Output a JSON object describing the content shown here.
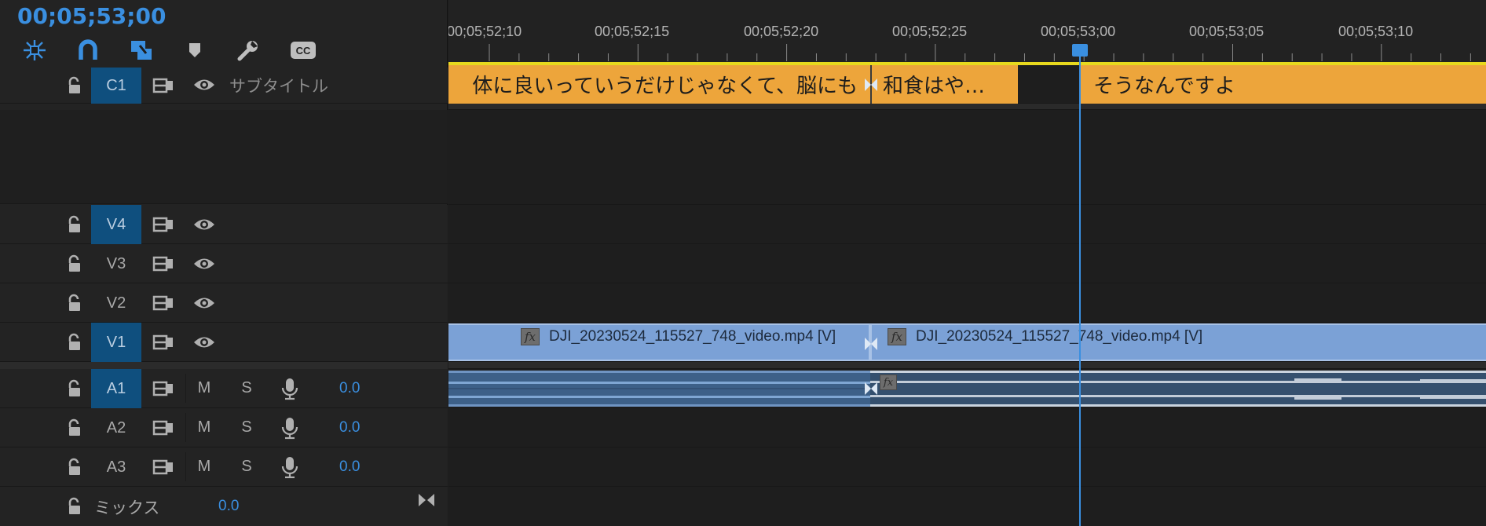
{
  "timecode": "00;05;53;00",
  "toolbar": {
    "tools": [
      {
        "icon": "nest-sequence-icon"
      },
      {
        "icon": "snap-magnet-icon"
      },
      {
        "icon": "linked-selection-icon"
      },
      {
        "icon": "add-marker-icon"
      },
      {
        "icon": "settings-wrench-icon"
      },
      {
        "icon": "captions-cc-icon",
        "text": "CC"
      }
    ]
  },
  "tracks": {
    "c1": {
      "name": "C1",
      "label": "サブタイトル"
    },
    "v4": {
      "name": "V4"
    },
    "v3": {
      "name": "V3"
    },
    "v2": {
      "name": "V2"
    },
    "v1": {
      "name": "V1"
    },
    "a1": {
      "name": "A1",
      "m": "M",
      "s": "S",
      "volume": "0.0"
    },
    "a2": {
      "name": "A2",
      "m": "M",
      "s": "S",
      "volume": "0.0"
    },
    "a3": {
      "name": "A3",
      "m": "M",
      "s": "S",
      "volume": "0.0"
    },
    "mix": {
      "label": "ミックス",
      "volume": "0.0"
    }
  },
  "ruler": {
    "labels": [
      "00;05;52;10",
      "00;05;52;15",
      "00;05;52;20",
      "00;05;52;25",
      "00;05;53;00",
      "00;05;53;05",
      "00;05;53;10"
    ]
  },
  "captions": [
    {
      "text": "体に良いっていうだけじゃなくて、脳にも"
    },
    {
      "text": "和食はや…"
    },
    {
      "text": "そうなんですよ"
    }
  ],
  "video_clips": [
    {
      "name": "DJI_20230524_115527_748_video.mp4 [V]"
    },
    {
      "name": "DJI_20230524_115527_748_video.mp4 [V]"
    }
  ],
  "colors": {
    "accent": "#3a8fe0",
    "caption_clip": "#eda53b",
    "video_clip": "#7ba1d6",
    "audio_clip": "#35506e",
    "work_area": "#e8d91e",
    "active_track": "#0f4f7e"
  }
}
